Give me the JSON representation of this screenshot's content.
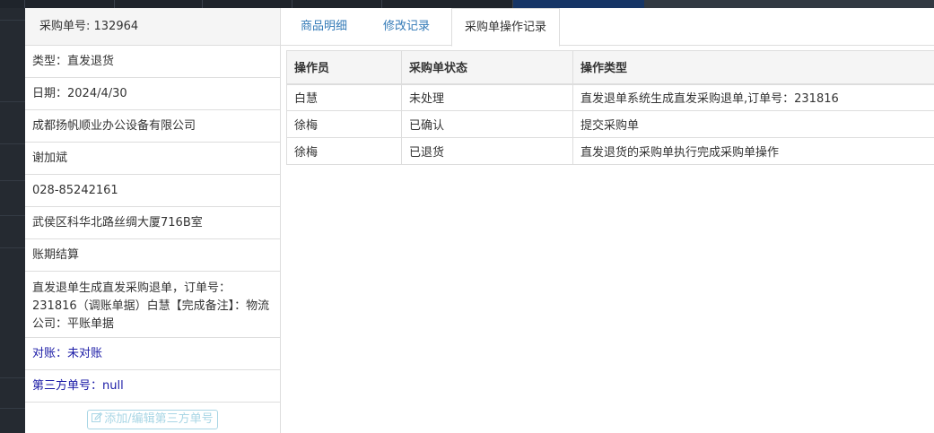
{
  "order_header": "采购单号: 132964",
  "info": {
    "type": "类型：直发退货",
    "date": "日期：2024/4/30",
    "company": "成都扬帆顺业办公设备有限公司",
    "contact": "谢加斌",
    "phone": "028-85242161",
    "address": "武侯区科华北路丝绸大厦716B室",
    "payment": "账期结算",
    "remark": "直发退单生成直发采购退单，订单号：231816（调账单据）白慧【完成备注】：物流公司：平账单据",
    "reconcile": "对账：未对账",
    "third_party": "第三方单号：null"
  },
  "edit_button_label": "添加/编辑第三方单号",
  "edit_button_icon": "edit-icon",
  "tabs": [
    {
      "label": "商品明细",
      "active": false
    },
    {
      "label": "修改记录",
      "active": false
    },
    {
      "label": "采购单操作记录",
      "active": true
    }
  ],
  "log_table": {
    "headers": [
      "操作员",
      "采购单状态",
      "操作类型"
    ],
    "rows": [
      [
        "白慧",
        "未处理",
        "直发退单系统生成直发采购退单,订单号：231816"
      ],
      [
        "徐梅",
        "已确认",
        "提交采购单"
      ],
      [
        "徐梅",
        "已退货",
        "直发退货的采购单执行完成采购单操作"
      ]
    ]
  },
  "colors": {
    "link": "#337ab7",
    "blue_text": "#1a1aa6",
    "button_border": "#a9d6e5"
  }
}
